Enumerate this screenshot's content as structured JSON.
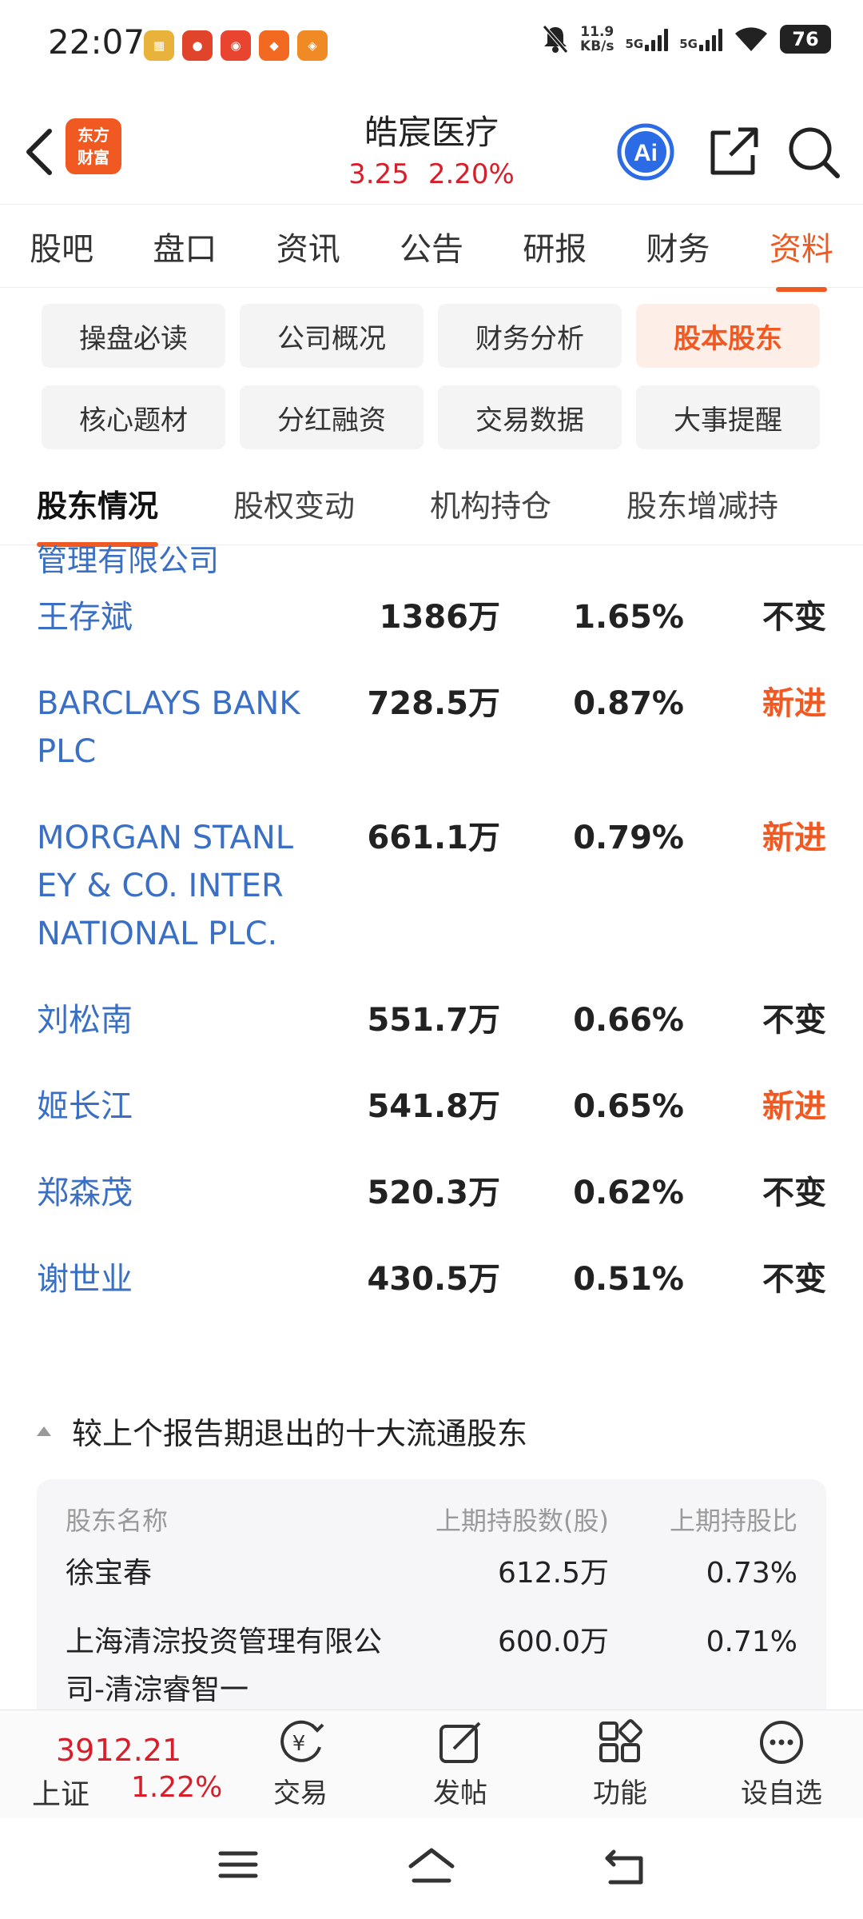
{
  "status_bar": {
    "time": "22:07",
    "net_speed_value": "11.9",
    "net_speed_unit": "KB/s",
    "signal1": "5G",
    "signal2": "5G",
    "battery": "76"
  },
  "header": {
    "logo_line1": "东方",
    "logo_line2": "财富",
    "stock_name": "皓宸医疗",
    "price": "3.25",
    "change_pct": "2.20%"
  },
  "main_tabs": [
    "股吧",
    "盘口",
    "资讯",
    "公告",
    "研报",
    "财务",
    "资料"
  ],
  "sub_buttons": [
    "操盘必读",
    "公司概况",
    "财务分析",
    "股本股东",
    "核心题材",
    "分红融资",
    "交易数据",
    "大事提醒"
  ],
  "section_tabs": [
    "股东情况",
    "股权变动",
    "机构持仓",
    "股东增减持"
  ],
  "holders": {
    "clipped_name": "管理有限公司",
    "rows": [
      {
        "name": "王存斌",
        "shares": "1386万",
        "pct": "1.65%",
        "change": "不变"
      },
      {
        "name": "BARCLAYS BANK PLC",
        "shares": "728.5万",
        "pct": "0.87%",
        "change": "新进"
      },
      {
        "name": "MORGAN STANLEY & CO. INTERNATIONAL PLC.",
        "shares": "661.1万",
        "pct": "0.79%",
        "change": "新进"
      },
      {
        "name": "刘松南",
        "shares": "551.7万",
        "pct": "0.66%",
        "change": "不变"
      },
      {
        "name": "姬长江",
        "shares": "541.8万",
        "pct": "0.65%",
        "change": "新进"
      },
      {
        "name": "郑森茂",
        "shares": "520.3万",
        "pct": "0.62%",
        "change": "不变"
      },
      {
        "name": "谢世业",
        "shares": "430.5万",
        "pct": "0.51%",
        "change": "不变"
      }
    ]
  },
  "exited": {
    "title": "较上个报告期退出的十大流通股东",
    "headers": [
      "股东名称",
      "上期持股数(股)",
      "上期持股比"
    ],
    "rows": [
      {
        "name": "徐宝春",
        "shares": "612.5万",
        "pct": "0.73%"
      },
      {
        "name": "上海清淙投资管理有限公司-清淙睿智一",
        "shares": "600.0万",
        "pct": "0.71%"
      }
    ]
  },
  "bottom_bar": {
    "index_value": "3912.21",
    "index_name": "上证",
    "index_pct": "1.22%",
    "items": [
      "交易",
      "发帖",
      "功能",
      "设自选"
    ]
  },
  "colors": {
    "accent": "#f05a22",
    "rise": "#d81e2a",
    "link": "#3a6fc4"
  }
}
